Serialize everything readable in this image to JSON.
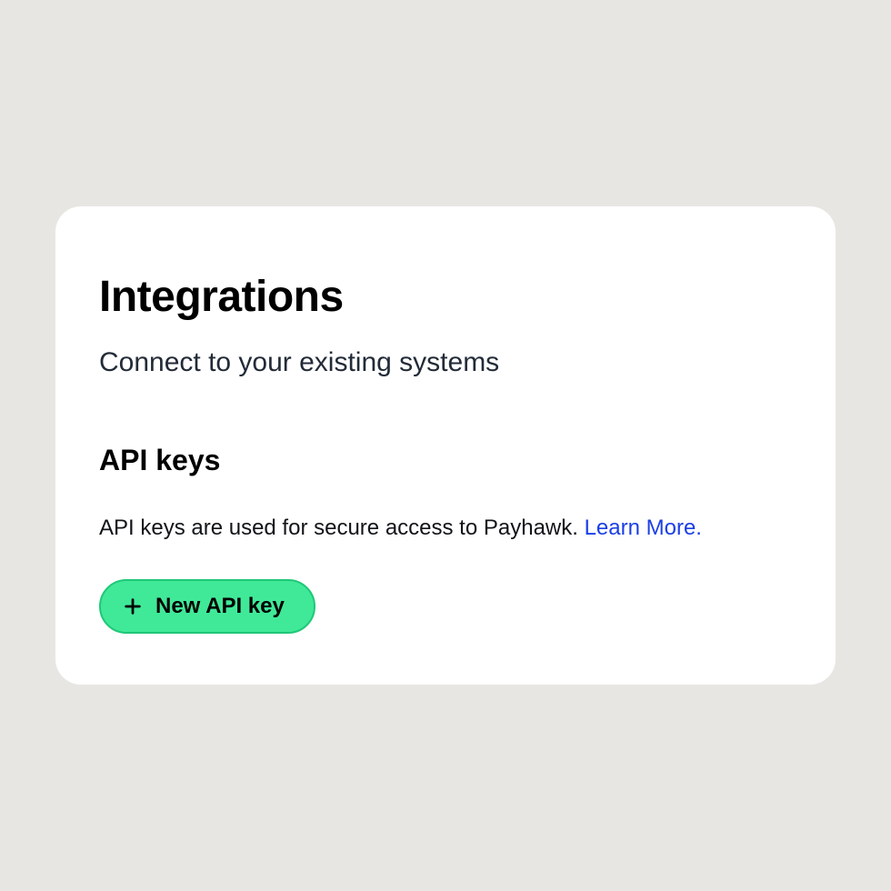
{
  "header": {
    "title": "Integrations",
    "subtitle": "Connect to your existing systems"
  },
  "api_keys": {
    "section_title": "API keys",
    "description": "API keys are used for secure access to Payhawk. ",
    "learn_more_label": "Learn More.",
    "new_key_button_label": "New API key"
  },
  "colors": {
    "page_bg": "#e8e6e3",
    "card_bg": "#ffffff",
    "button_bg": "#40e998",
    "button_border": "#1fc878",
    "link": "#1a3fe6"
  }
}
